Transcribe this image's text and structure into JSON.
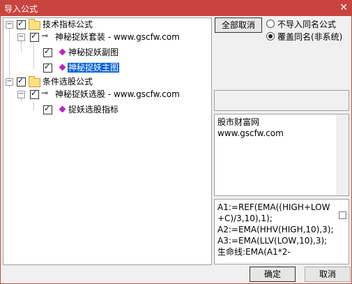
{
  "window": {
    "title": "导入公式",
    "close_glyph": "✕"
  },
  "tree": {
    "nodes": [
      {
        "label": "技术指标公式"
      },
      {
        "label": "神秘捉妖套装 - www.gscfw.com"
      },
      {
        "label": "神秘捉妖副图"
      },
      {
        "label": "神秘捉妖主图",
        "selected": true
      },
      {
        "label": "条件选股公式"
      },
      {
        "label": "神秘捉妖选股 - www.gscfw.com"
      },
      {
        "label": "捉妖选股指标"
      }
    ]
  },
  "options": {
    "select_all_label": "全部取消",
    "radio_no_import": "不导入同名公式",
    "radio_overwrite": "覆盖同名(非系统)",
    "selected_radio": "overwrite"
  },
  "info": {
    "line1": "股市财富网",
    "line2": "www.gscfw.com"
  },
  "formula": {
    "lines": [
      "A1:=REF(EMA((HIGH+LOW",
      "+C)/3,10),1);",
      "A2:=EMA(HHV(HIGH,10),3);",
      "A3:=EMA(LLV(LOW,10),3);",
      "生命线:EMA(A1*2-"
    ]
  },
  "footer": {
    "ok_label": "确定",
    "cancel_label": "取消"
  }
}
